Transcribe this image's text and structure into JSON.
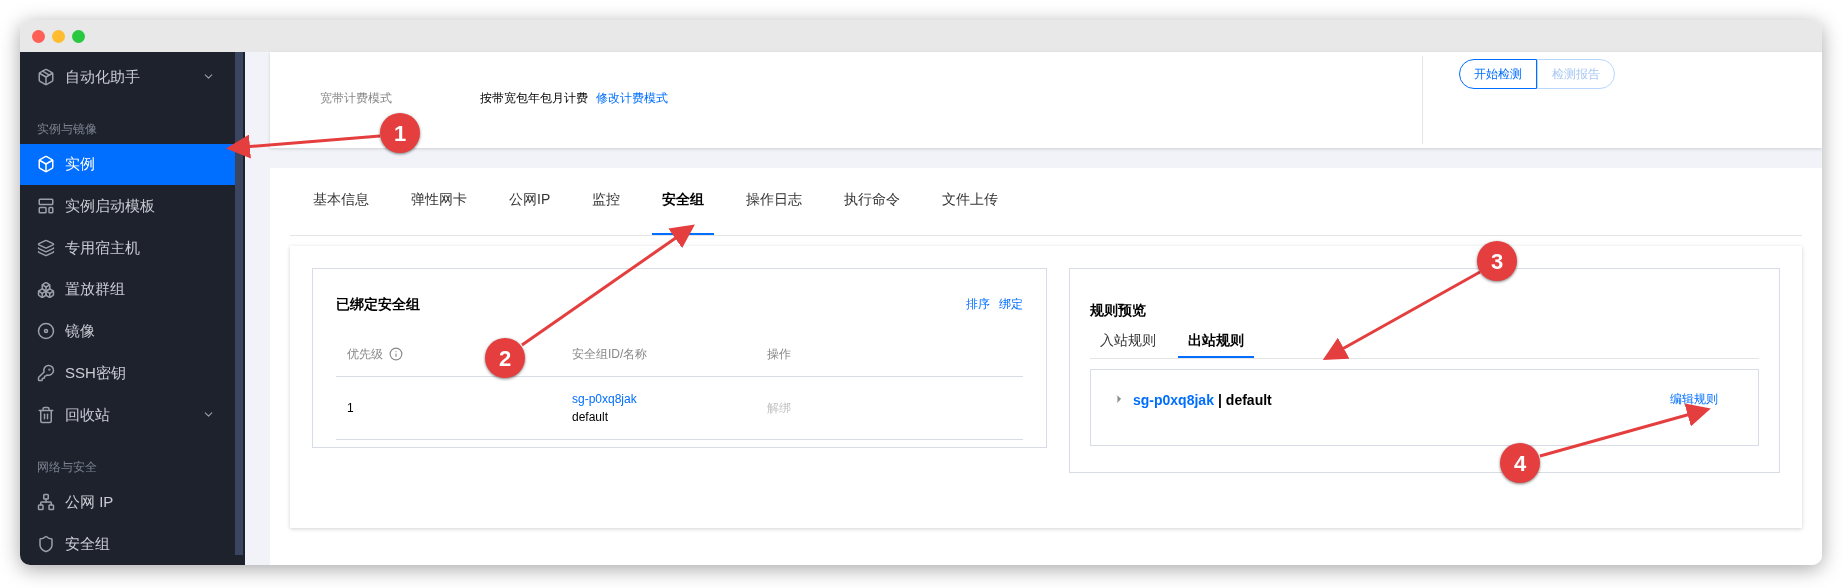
{
  "sidebar": {
    "items": [
      {
        "kind": "item",
        "label": "自动化助手",
        "expandable": true,
        "selected": false
      },
      {
        "kind": "section",
        "label": "实例与镜像"
      },
      {
        "kind": "item",
        "label": "实例",
        "expandable": false,
        "selected": true
      },
      {
        "kind": "item",
        "label": "实例启动模板",
        "expandable": false,
        "selected": false
      },
      {
        "kind": "item",
        "label": "专用宿主机",
        "expandable": false,
        "selected": false
      },
      {
        "kind": "item",
        "label": "置放群组",
        "expandable": false,
        "selected": false
      },
      {
        "kind": "item",
        "label": "镜像",
        "expandable": false,
        "selected": false
      },
      {
        "kind": "item",
        "label": "SSH密钥",
        "expandable": false,
        "selected": false
      },
      {
        "kind": "item",
        "label": "回收站",
        "expandable": true,
        "selected": false
      },
      {
        "kind": "section",
        "label": "网络与安全"
      },
      {
        "kind": "item",
        "label": "公网 IP",
        "expandable": false,
        "selected": false
      },
      {
        "kind": "item",
        "label": "安全组",
        "expandable": false,
        "selected": false
      }
    ]
  },
  "instance_info": {
    "rows": [
      {
        "label": "宽带计费模式",
        "value": "按带宽包年包月计费",
        "link": "修改计费模式"
      }
    ],
    "buttons": [
      {
        "label": "开始检测",
        "disabled": false
      },
      {
        "label": "检测报告",
        "disabled": true
      }
    ]
  },
  "tabs": [
    {
      "label": "基本信息",
      "selected": false
    },
    {
      "label": "弹性网卡",
      "selected": false
    },
    {
      "label": "公网IP",
      "selected": false
    },
    {
      "label": "监控",
      "selected": false
    },
    {
      "label": "安全组",
      "selected": true
    },
    {
      "label": "操作日志",
      "selected": false
    },
    {
      "label": "执行命令",
      "selected": false
    },
    {
      "label": "文件上传",
      "selected": false
    }
  ],
  "bound_groups": {
    "title": "已绑定安全组",
    "actions": [
      "排序",
      "绑定"
    ],
    "columns": [
      "优先级",
      "安全组ID/名称",
      "操作"
    ],
    "rows": [
      {
        "priority": "1",
        "id": "sg-p0xq8jak",
        "name": "default",
        "action": "解绑",
        "action_disabled": true
      }
    ]
  },
  "rules_preview": {
    "title": "规则预览",
    "tabs": [
      {
        "label": "入站规则",
        "selected": false
      },
      {
        "label": "出站规则",
        "selected": true
      }
    ],
    "groups": [
      {
        "id": "sg-p0xq8jak",
        "separator": "|",
        "name": "default",
        "expanded": false,
        "action": "编辑规则"
      }
    ]
  },
  "annotations": [
    {
      "label": "1"
    },
    {
      "label": "2"
    },
    {
      "label": "3"
    },
    {
      "label": "4"
    }
  ]
}
